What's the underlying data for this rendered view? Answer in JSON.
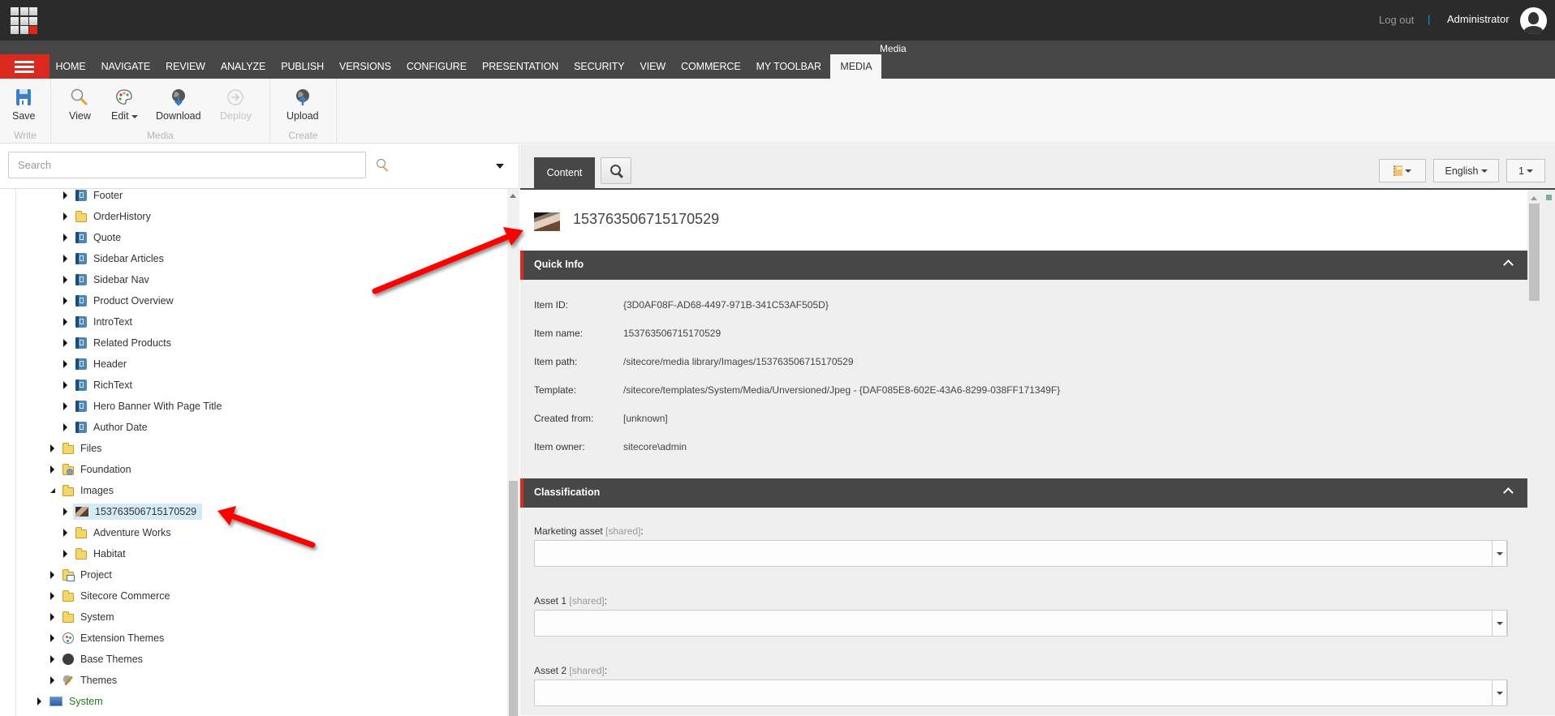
{
  "topbar": {
    "logout_label": "Log out",
    "separator": "|",
    "username": "Administrator"
  },
  "ribbon": {
    "tabs": [
      {
        "label": "HOME"
      },
      {
        "label": "NAVIGATE"
      },
      {
        "label": "REVIEW"
      },
      {
        "label": "ANALYZE"
      },
      {
        "label": "PUBLISH"
      },
      {
        "label": "VERSIONS"
      },
      {
        "label": "CONFIGURE"
      },
      {
        "label": "PRESENTATION"
      },
      {
        "label": "SECURITY"
      },
      {
        "label": "VIEW"
      },
      {
        "label": "COMMERCE"
      },
      {
        "label": "MY TOOLBAR"
      },
      {
        "label": "MEDIA",
        "active": true
      }
    ],
    "contextual_label": "Media",
    "groups": {
      "write": {
        "title": "Write",
        "save": "Save"
      },
      "media": {
        "title": "Media",
        "view": "View",
        "edit": "Edit",
        "download": "Download",
        "deploy": "Deploy"
      },
      "create": {
        "title": "Create",
        "upload": "Upload"
      }
    }
  },
  "content_tree": {
    "search_placeholder": "Search",
    "items": [
      {
        "label": "Footer",
        "icon": "rendering-icon"
      },
      {
        "label": "OrderHistory",
        "icon": "folder-icon"
      },
      {
        "label": "Quote",
        "icon": "rendering-icon"
      },
      {
        "label": "Sidebar Articles",
        "icon": "rendering-icon"
      },
      {
        "label": "Sidebar Nav",
        "icon": "rendering-icon"
      },
      {
        "label": "Product Overview",
        "icon": "rendering-icon"
      },
      {
        "label": "IntroText",
        "icon": "rendering-icon"
      },
      {
        "label": "Related Products",
        "icon": "rendering-icon"
      },
      {
        "label": "Header",
        "icon": "rendering-icon"
      },
      {
        "label": "RichText",
        "icon": "rendering-icon"
      },
      {
        "label": "Hero Banner With Page Title",
        "icon": "rendering-icon"
      },
      {
        "label": "Author Date",
        "icon": "rendering-icon"
      },
      {
        "label": "Files",
        "icon": "folder-icon"
      },
      {
        "label": "Foundation",
        "icon": "folder-gear-icon"
      },
      {
        "label": "Images",
        "icon": "folder-icon",
        "expanded": true
      },
      {
        "label": "153763506715170529",
        "icon": "image-thumbnail-icon",
        "selected": true
      },
      {
        "label": "Adventure Works",
        "icon": "folder-icon"
      },
      {
        "label": "Habitat",
        "icon": "folder-icon"
      },
      {
        "label": "Project",
        "icon": "folder-project-icon"
      },
      {
        "label": "Sitecore Commerce",
        "icon": "folder-icon"
      },
      {
        "label": "System",
        "icon": "folder-icon"
      },
      {
        "label": "Extension Themes",
        "icon": "palette-icon"
      },
      {
        "label": "Base Themes",
        "icon": "dark-palette-icon"
      },
      {
        "label": "Themes",
        "icon": "paintbrush-icon"
      },
      {
        "label": "System",
        "icon": "system-icon"
      }
    ]
  },
  "editor": {
    "tabs": {
      "content": "Content"
    },
    "language": "English",
    "version": "1",
    "item_title": "153763506715170529",
    "quick_info": {
      "title": "Quick Info",
      "rows": [
        {
          "label": "Item ID:",
          "value": "{3D0AF08F-AD68-4497-971B-341C53AF505D}"
        },
        {
          "label": "Item name:",
          "value": "153763506715170529"
        },
        {
          "label": "Item path:",
          "value": "/sitecore/media library/Images/153763506715170529"
        },
        {
          "label": "Template:",
          "value": "/sitecore/templates/System/Media/Unversioned/Jpeg - {DAF085E8-602E-43A6-8299-038FF171349F}"
        },
        {
          "label": "Created from:",
          "value": "[unknown]"
        },
        {
          "label": "Item owner:",
          "value": "sitecore\\admin"
        }
      ]
    },
    "classification": {
      "title": "Classification",
      "fields": [
        {
          "label": "Marketing asset",
          "shared": "[shared]",
          "suffix": ":",
          "value": ""
        },
        {
          "label": "Asset 1",
          "shared": "[shared]",
          "suffix": ":",
          "value": ""
        },
        {
          "label": "Asset 2",
          "shared": "[shared]",
          "suffix": ":",
          "value": ""
        }
      ]
    }
  },
  "colors": {
    "accent_red": "#dc291e",
    "topbar": "#2b2b2b",
    "tabstrip": "#474747",
    "selection": "#d4eaf7",
    "annotation_arrow": "#ff0000"
  }
}
